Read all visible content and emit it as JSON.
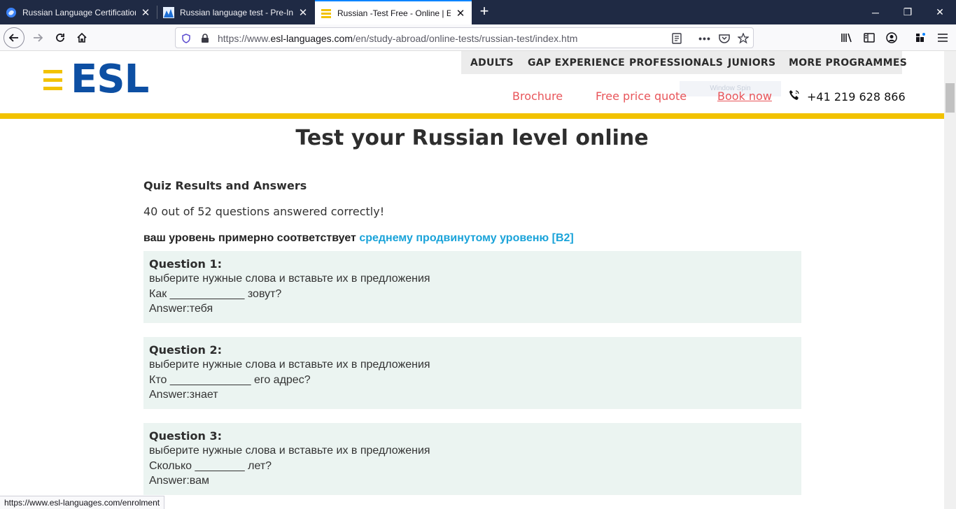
{
  "browser": {
    "tabs": [
      {
        "title": "Russian Language Certification",
        "active": false
      },
      {
        "title": "Russian language test - Pre-Inte",
        "active": false
      },
      {
        "title": "Russian -Test Free - Online | ESL",
        "active": true
      }
    ],
    "url_prefix": "https://www.",
    "url_host": "esl-languages.com",
    "url_path": "/en/study-abroad/online-tests/russian-test/index.htm",
    "status_url": "https://www.esl-languages.com/enrolment"
  },
  "site": {
    "logo_text": "ESL",
    "top_nav": [
      "ADULTS",
      "GAP EXPERIENCE",
      "PROFESSIONALS",
      "JUNIORS",
      "MORE PROGRAMMES"
    ],
    "ghost_text": "Window Spin",
    "links": {
      "brochure": "Brochure",
      "quote": "Free price quote",
      "book": "Book now"
    },
    "phone": "+41 219 628 866",
    "accent_color": "#f2c200",
    "brand_color": "#0d4fa3",
    "link_color": "#e8555a"
  },
  "content": {
    "heading": "Test your Russian level online",
    "results_title": "Quiz Results and Answers",
    "score_text": "40 out of 52 questions answered correctly!",
    "level_prefix": "ваш уровень примерно соответствует",
    "level_value": "среднему продвинутому уровеню [B2]",
    "questions": [
      {
        "title": "Question 1:",
        "instruction": "выберите нужные слова и вставьте их в предложения",
        "sentence": "Как ____________ зовут?",
        "answer": "Answer:тебя"
      },
      {
        "title": "Question 2:",
        "instruction": "выберите нужные слова и вставьте их в предложения",
        "sentence": "Кто _____________ его адрес?",
        "answer": "Answer:знает"
      },
      {
        "title": "Question 3:",
        "instruction": "выберите нужные слова и вставьте их в предложения",
        "sentence": "Сколько ________ лет?",
        "answer": "Answer:вам"
      }
    ]
  }
}
